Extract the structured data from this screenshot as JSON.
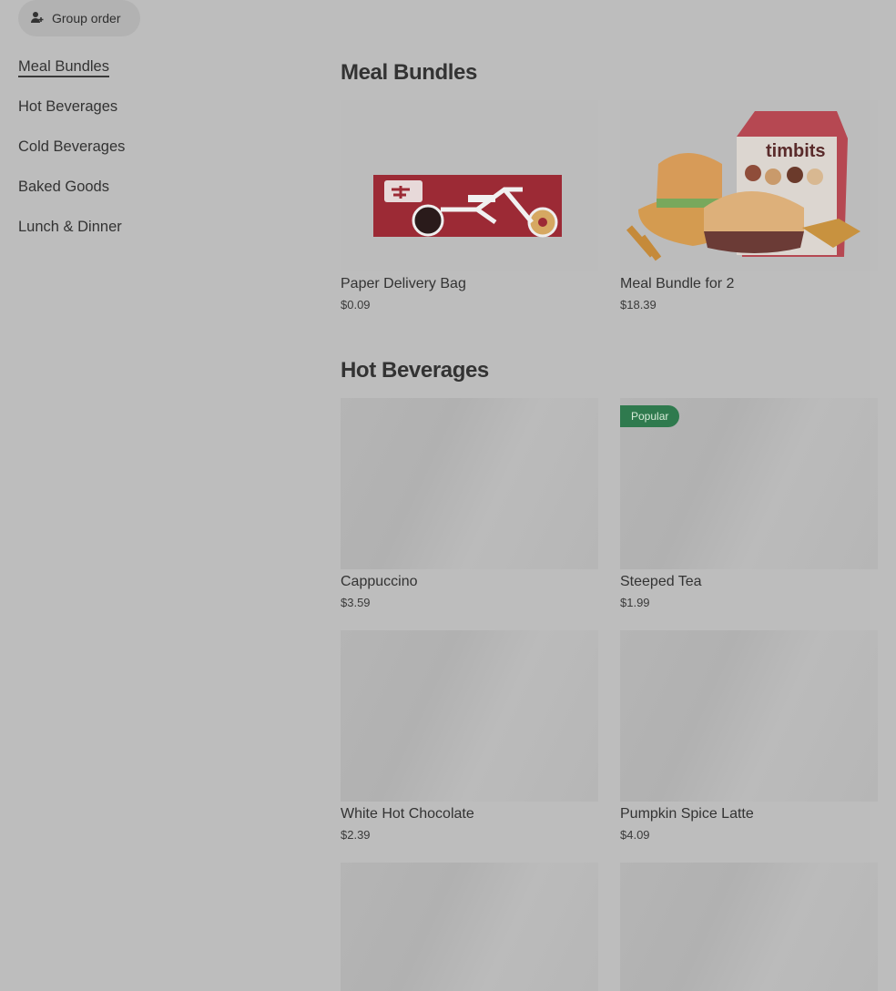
{
  "header": {
    "group_order_label": "Group order",
    "group_order_icon": "add-user-icon"
  },
  "sidebar": {
    "items": [
      {
        "label": "Meal Bundles",
        "active": true
      },
      {
        "label": "Hot Beverages"
      },
      {
        "label": "Cold Beverages"
      },
      {
        "label": "Baked Goods"
      },
      {
        "label": "Lunch & Dinner"
      }
    ]
  },
  "sections": [
    {
      "title": "Meal Bundles",
      "items": [
        {
          "name": "Paper Delivery Bag",
          "price": "$0.09"
        },
        {
          "name": "Meal Bundle for 2",
          "price": "$18.39"
        }
      ]
    },
    {
      "title": "Hot Beverages",
      "items": [
        {
          "name": "Cappuccino",
          "price": "$3.59"
        },
        {
          "name": "Steeped Tea",
          "price": "$1.99",
          "badge": "Popular"
        },
        {
          "name": "White Hot Chocolate",
          "price": "$2.39"
        },
        {
          "name": "Pumpkin Spice Latte",
          "price": "$4.09"
        }
      ]
    }
  ],
  "colors": {
    "overlay_bg": "#bdbdbd",
    "badge_bg": "#2f7a4e",
    "bag_red": "#9c2a35"
  }
}
